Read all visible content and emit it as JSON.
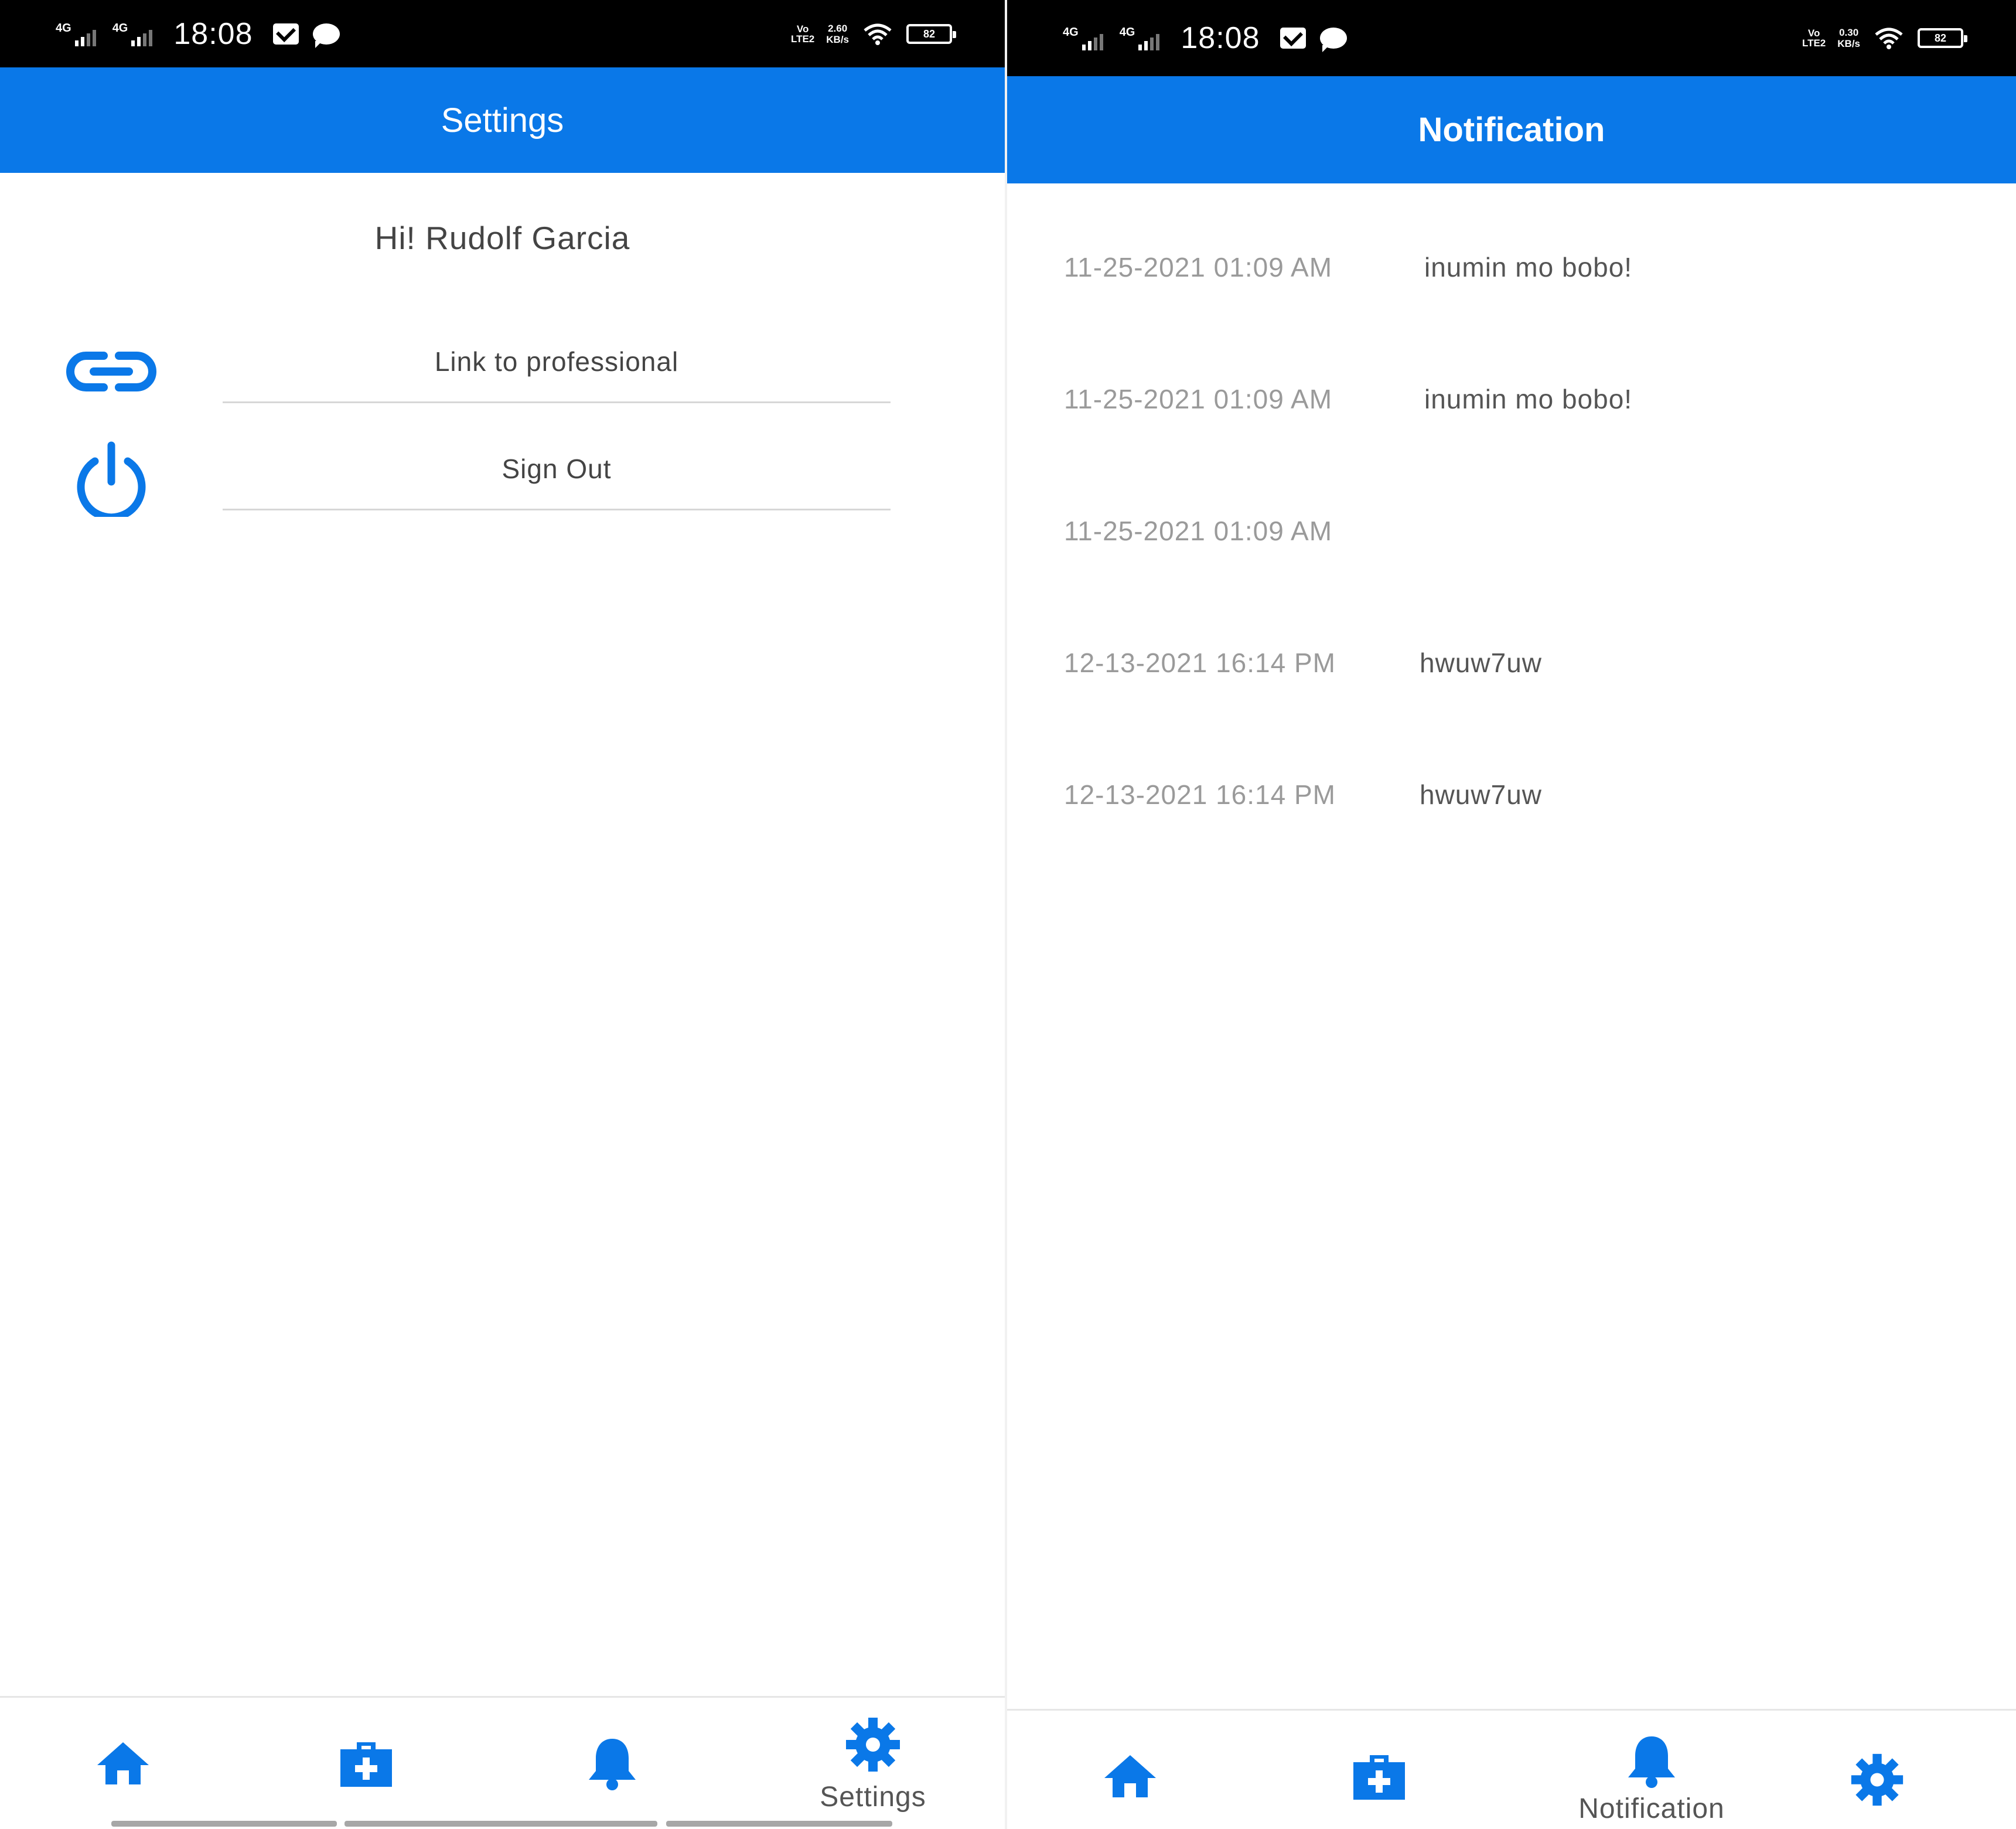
{
  "left_screen": {
    "status_bar": {
      "network_1": "4G",
      "network_2": "4G",
      "time": "18:08",
      "volte_top": "Vo",
      "volte_bottom": "LTE2",
      "speed_value": "2.60",
      "speed_unit": "KB/s",
      "battery": "82"
    },
    "header": {
      "title": "Settings"
    },
    "greeting": "Hi! Rudolf Garcia",
    "menu": [
      {
        "label": "Link to professional",
        "icon": "link-icon"
      },
      {
        "label": "Sign Out",
        "icon": "power-icon"
      }
    ],
    "bottom_nav": {
      "active_label": "Settings",
      "items": [
        {
          "icon": "home-icon"
        },
        {
          "icon": "medical-kit-icon"
        },
        {
          "icon": "bell-icon"
        },
        {
          "icon": "gear-icon"
        }
      ]
    }
  },
  "right_screen": {
    "status_bar": {
      "network_1": "4G",
      "network_2": "4G",
      "time": "18:08",
      "volte_top": "Vo",
      "volte_bottom": "LTE2",
      "speed_value": "0.30",
      "speed_unit": "KB/s",
      "battery": "82"
    },
    "header": {
      "title": "Notification"
    },
    "notifications": [
      {
        "date": "11-25-2021 01:09 AM",
        "message": "inumin mo bobo!"
      },
      {
        "date": "11-25-2021 01:09 AM",
        "message": "inumin mo bobo!"
      },
      {
        "date": "11-25-2021 01:09 AM",
        "message": ""
      },
      {
        "date": "12-13-2021 16:14 PM",
        "message": "hwuw7uw"
      },
      {
        "date": "12-13-2021 16:14 PM",
        "message": "hwuw7uw"
      }
    ],
    "bottom_nav": {
      "active_label": "Notification",
      "items": [
        {
          "icon": "home-icon"
        },
        {
          "icon": "medical-kit-icon"
        },
        {
          "icon": "bell-icon"
        },
        {
          "icon": "gear-icon"
        }
      ]
    }
  },
  "colors": {
    "accent": "#0a78e8",
    "status_bar": "#000000",
    "text_primary": "#444444",
    "text_muted": "#9a9a9a"
  }
}
